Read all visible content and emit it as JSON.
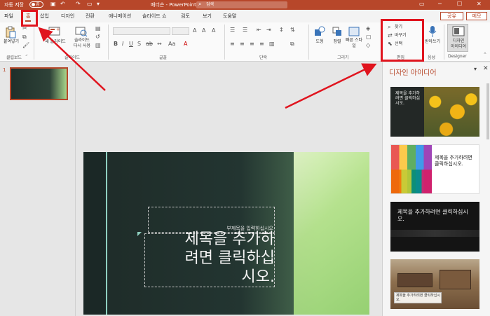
{
  "titlebar": {
    "autosave_label": "자동 저장",
    "autosave_state": "끔",
    "doc_title": "매더슨 - PowerPoint",
    "search_placeholder": "검색",
    "search_icon": "search-icon"
  },
  "tabs": [
    {
      "label": "파일"
    },
    {
      "label": "홈",
      "active": true
    },
    {
      "label": "삽입"
    },
    {
      "label": "디자인"
    },
    {
      "label": "전환"
    },
    {
      "label": "애니메이션"
    },
    {
      "label": "슬라이드 쇼"
    },
    {
      "label": "검토"
    },
    {
      "label": "보기"
    },
    {
      "label": "도움말"
    }
  ],
  "header_buttons": {
    "share": "공유",
    "comments": "메모"
  },
  "ribbon": {
    "clipboard": {
      "paste": "붙여넣기",
      "label": "클립보드"
    },
    "slides": {
      "new_slide": "새 슬라이드",
      "reuse_slides_line1": "슬라이드",
      "reuse_slides_line2": "다시 사용",
      "label": "슬라이드"
    },
    "font": {
      "label": "글꼴"
    },
    "paragraph": {
      "label": "단락"
    },
    "drawing": {
      "shapes": "도형",
      "arrange": "정렬",
      "quick_styles": "빠른 스타일",
      "label": "그리기"
    },
    "editing": {
      "find": "찾기",
      "replace": "바꾸기",
      "select": "선택",
      "label": "편집"
    },
    "voice": {
      "dictate": "받아쓰기",
      "label": "음성"
    },
    "designer": {
      "btn_line1": "디자인",
      "btn_line2": "아이디어",
      "label": "Designer"
    }
  },
  "thumbnail_pane": {
    "slide_number": "1"
  },
  "slide": {
    "subtitle_placeholder": "부제목을 입력하십시오",
    "title_placeholder_line1": "제목을 추가하",
    "title_placeholder_line2": "려면 클릭하십",
    "title_placeholder_line3": "시오."
  },
  "designer_pane": {
    "title": "디자인 아이디어",
    "ideas": [
      {
        "text": "제목을 추가하려면 클릭하십시오."
      },
      {
        "text": "제목을 추가하려면 클릭하십시오."
      },
      {
        "text": "제목을 추가하려면 클릭하십시오."
      },
      {
        "text": "제목을 추가하려면 클릭하십시오."
      }
    ]
  },
  "colors": {
    "accent": "#b7472a",
    "highlight": "#e0141e",
    "slide_dark": "#1e2b28",
    "slide_green": "#a7d58a"
  }
}
